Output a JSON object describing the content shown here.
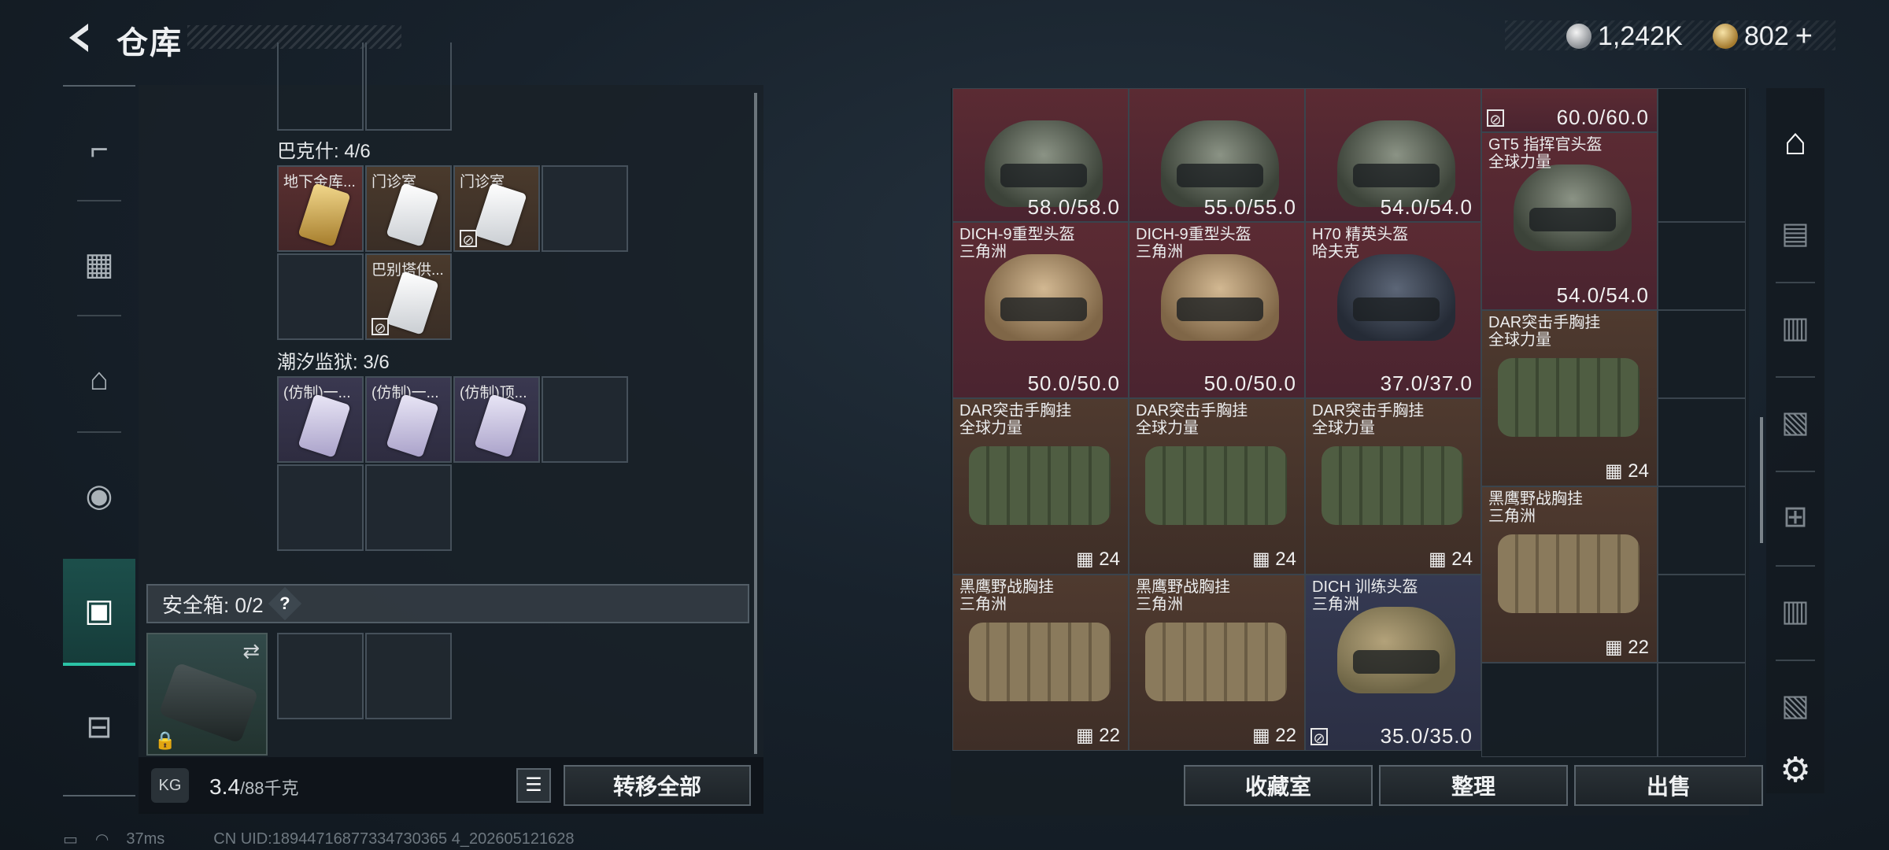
{
  "header": {
    "title": "仓库",
    "currency": [
      {
        "icon": "silver-coin-icon",
        "value": "1,242K"
      },
      {
        "icon": "gold-coin-icon",
        "value": "802"
      }
    ],
    "add_symbol": "+"
  },
  "sidebar": {
    "items": [
      {
        "icon": "weapon-icon",
        "active": false
      },
      {
        "icon": "armor-icon",
        "active": false
      },
      {
        "icon": "backpack-icon",
        "active": false
      },
      {
        "icon": "bag-icon",
        "active": false
      },
      {
        "icon": "safe-box-icon",
        "active": true
      },
      {
        "icon": "toolbox-icon",
        "active": false
      }
    ]
  },
  "left": {
    "sections": [
      {
        "title": "巴克什: 4/6",
        "cells": [
          {
            "label": "地下金库...",
            "color": "red",
            "card": "goldcard",
            "noflag": false
          },
          {
            "label": "门诊室",
            "color": "gold",
            "card": "card",
            "noflag": false
          },
          {
            "label": "门诊室",
            "color": "gold",
            "card": "card",
            "noflag": true
          },
          {
            "label": "巴别塔供...",
            "color": "gold",
            "card": "card",
            "noflag": true
          }
        ]
      },
      {
        "title": "潮汐监狱: 3/6",
        "cells": [
          {
            "label": "(仿制)一...",
            "color": "purple",
            "card": "purplecard",
            "noflag": false
          },
          {
            "label": "(仿制)一...",
            "color": "purple",
            "card": "purplecard",
            "noflag": false
          },
          {
            "label": "(仿制)顶...",
            "color": "purple",
            "card": "purplecard",
            "noflag": false
          }
        ]
      }
    ],
    "safe_box": {
      "label": "安全箱: 0/2",
      "help": "?"
    },
    "weight": {
      "current": "3.4",
      "max": "/88千克"
    },
    "transfer_all": "转移全部"
  },
  "right": {
    "items": [
      {
        "col": 0,
        "row": 0,
        "h": 1,
        "name": "",
        "sub": "",
        "color": "red",
        "kind": "helmet green",
        "value": "58.0/58.0"
      },
      {
        "col": 1,
        "row": 0,
        "h": 1,
        "name": "",
        "sub": "",
        "color": "red",
        "kind": "helmet green",
        "value": "55.0/55.0"
      },
      {
        "col": 2,
        "row": 0,
        "h": 1,
        "name": "",
        "sub": "",
        "color": "red",
        "kind": "helmet green",
        "value": "54.0/54.0"
      },
      {
        "col": 3,
        "row": 0,
        "h": 0,
        "name": "",
        "sub": "",
        "color": "red",
        "kind": "",
        "value": "60.0/60.0",
        "noflag": true
      },
      {
        "col": 3,
        "row": 1,
        "h": 2,
        "name": "GT5 指挥官头盔",
        "sub": "全球力量",
        "color": "red",
        "kind": "helmet green",
        "value": "54.0/54.0"
      },
      {
        "col": 0,
        "row": 2,
        "h": 2,
        "name": "DICH-9重型头盔",
        "sub": "三角洲",
        "color": "red",
        "kind": "helmet tan",
        "value": "50.0/50.0"
      },
      {
        "col": 1,
        "row": 2,
        "h": 2,
        "name": "DICH-9重型头盔",
        "sub": "三角洲",
        "color": "red",
        "kind": "helmet tan",
        "value": "50.0/50.0"
      },
      {
        "col": 2,
        "row": 2,
        "h": 2,
        "name": "H70 精英头盔",
        "sub": "哈夫克",
        "color": "red",
        "kind": "helmet dark",
        "value": "37.0/37.0"
      },
      {
        "col": 3,
        "row": 3,
        "h": 2,
        "name": "DAR突击手胸挂",
        "sub": "全球力量",
        "color": "brown",
        "kind": "vest green",
        "cap": "24"
      },
      {
        "col": 0,
        "row": 4,
        "h": 2,
        "name": "DAR突击手胸挂",
        "sub": "全球力量",
        "color": "brown",
        "kind": "vest green",
        "cap": "24"
      },
      {
        "col": 1,
        "row": 4,
        "h": 2,
        "name": "DAR突击手胸挂",
        "sub": "全球力量",
        "color": "brown",
        "kind": "vest green",
        "cap": "24"
      },
      {
        "col": 2,
        "row": 4,
        "h": 2,
        "name": "DAR突击手胸挂",
        "sub": "全球力量",
        "color": "brown",
        "kind": "vest green",
        "cap": "24"
      },
      {
        "col": 3,
        "row": 5,
        "h": 2,
        "name": "黑鹰野战胸挂",
        "sub": "三角洲",
        "color": "brown",
        "kind": "vest tan",
        "cap": "22"
      },
      {
        "col": 0,
        "row": 6,
        "h": 2,
        "name": "黑鹰野战胸挂",
        "sub": "三角洲",
        "color": "brown",
        "kind": "vest tan",
        "cap": "22"
      },
      {
        "col": 1,
        "row": 6,
        "h": 2,
        "name": "黑鹰野战胸挂",
        "sub": "三角洲",
        "color": "brown",
        "kind": "vest tan",
        "cap": "22"
      },
      {
        "col": 2,
        "row": 6,
        "h": 2,
        "name": "DICH 训练头盔",
        "sub": "三角洲",
        "color": "blue",
        "kind": "helmet camo",
        "value": "35.0/35.0",
        "noflag": true
      }
    ],
    "buttons": {
      "collection": "收藏室",
      "sort": "整理",
      "sell": "出售"
    }
  },
  "right_tabs": [
    {
      "icon": "warehouse-icon",
      "active": true
    },
    {
      "icon": "safe-icon",
      "active": false
    },
    {
      "icon": "storage-case-icon",
      "active": false
    },
    {
      "icon": "ammo-case-icon",
      "active": false
    },
    {
      "icon": "medical-case-icon",
      "active": false
    },
    {
      "icon": "storage-case-2-icon",
      "active": false
    },
    {
      "icon": "ammo-case-2-icon",
      "active": false
    },
    {
      "icon": "gear-icon",
      "active": false
    }
  ],
  "status": {
    "ping": "37ms",
    "uid": "CN UID:18944716877334730365 4_202605121628"
  },
  "colors": {
    "accent": "#2bc3a6",
    "red_rarity": "#5b2b33",
    "gold_rarity": "#4f3a2f",
    "blue_rarity": "#353a52"
  }
}
